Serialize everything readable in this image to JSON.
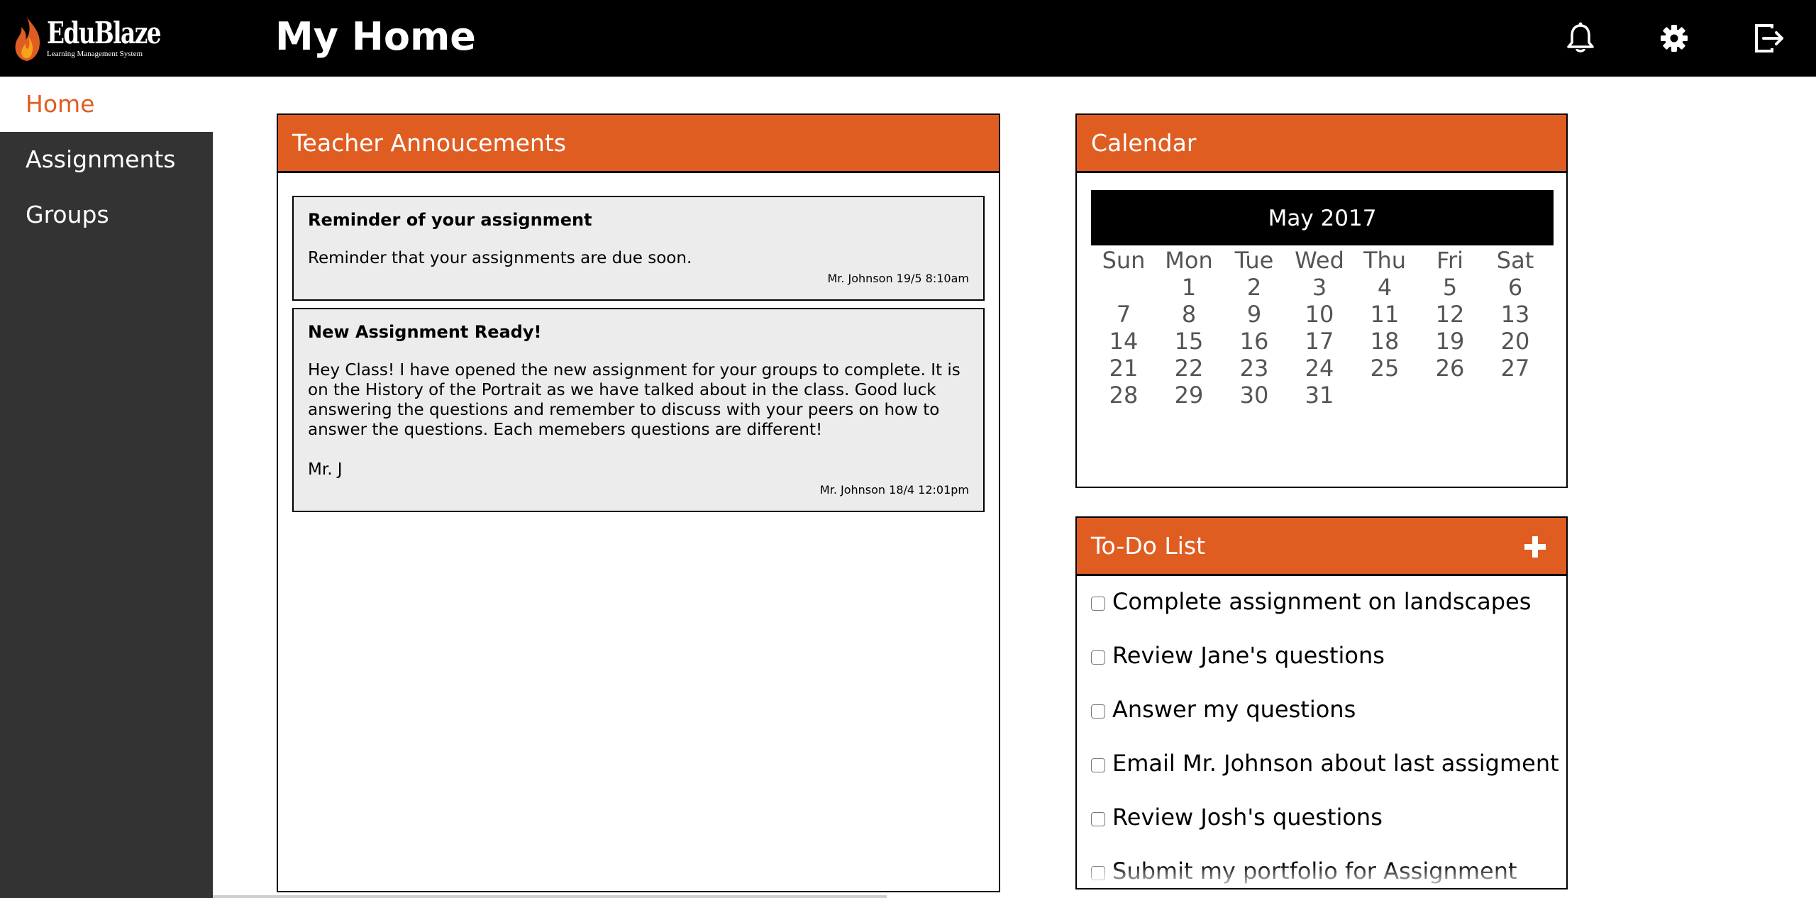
{
  "app": {
    "brand": "EduBlaze",
    "tagline": "Learning Management System",
    "page_title": "My Home"
  },
  "sidebar": {
    "items": [
      {
        "label": "Home",
        "active": true
      },
      {
        "label": "Assignments",
        "active": false
      },
      {
        "label": "Groups",
        "active": false
      }
    ]
  },
  "announcements": {
    "title": "Teacher Annoucements",
    "items": [
      {
        "title": "Reminder of your assignment",
        "body": "Reminder that your assignments are due soon.",
        "meta": "Mr. Johnson 19/5 8:10am"
      },
      {
        "title": "New Assignment Ready!",
        "body": "Hey Class! I have opened the new assignment for your groups to complete. It is on the History of the Portrait as we have talked about in the class. Good luck answering the questions and remember to discuss with your peers on how to answer the questions. Each memebers questions are different!\n\nMr. J",
        "meta": "Mr. Johnson 18/4 12:01pm"
      }
    ]
  },
  "calendar": {
    "title": "Calendar",
    "month_label": "May 2017",
    "weekdays": [
      "Sun",
      "Mon",
      "Tue",
      "Wed",
      "Thu",
      "Fri",
      "Sat"
    ],
    "weeks": [
      [
        "",
        "1",
        "2",
        "3",
        "4",
        "5",
        "6"
      ],
      [
        "7",
        "8",
        "9",
        "10",
        "11",
        "12",
        "13"
      ],
      [
        "14",
        "15",
        "16",
        "17",
        "18",
        "19",
        "20"
      ],
      [
        "21",
        "22",
        "23",
        "24",
        "25",
        "26",
        "27"
      ],
      [
        "28",
        "29",
        "30",
        "31",
        "",
        "",
        ""
      ]
    ]
  },
  "todo": {
    "title": "To-Do List",
    "add_icon": "plus-icon",
    "items": [
      {
        "label": "Complete assignment on landscapes",
        "checked": false
      },
      {
        "label": "Review Jane's questions",
        "checked": false
      },
      {
        "label": "Answer my questions",
        "checked": false
      },
      {
        "label": "Email Mr. Johnson about last assigment",
        "checked": false
      },
      {
        "label": "Review Josh's questions",
        "checked": false
      },
      {
        "label": "Submit my portfolio for Assignment",
        "checked": false
      }
    ]
  },
  "colors": {
    "accent": "#e05d22",
    "topbar": "#000000",
    "sidebar": "#333333",
    "card": "#ececec"
  },
  "icons": {
    "notifications": "bell-icon",
    "settings": "gear-icon",
    "logout": "logout-icon",
    "logo": "flame-icon"
  }
}
